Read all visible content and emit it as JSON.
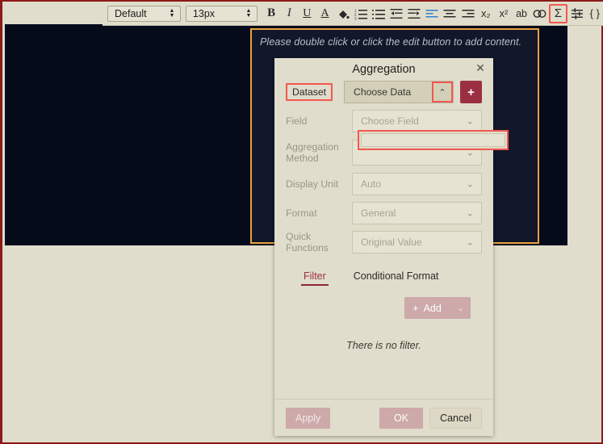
{
  "toolbar": {
    "font_family": {
      "value": "Default",
      "icon": "spinner-arrows-icon"
    },
    "font_size": {
      "value": "13px",
      "icon": "spinner-arrows-icon"
    },
    "buttons": [
      {
        "name": "bold",
        "glyph": "B",
        "icon": "bold-icon"
      },
      {
        "name": "italic",
        "glyph": "I",
        "icon": "italic-icon"
      },
      {
        "name": "underline",
        "glyph": "U",
        "icon": "underline-icon"
      },
      {
        "name": "font-color",
        "glyph": "A",
        "icon": "font-color-icon"
      },
      {
        "name": "fill-color",
        "glyph": "",
        "icon": "paint-bucket-icon"
      },
      {
        "name": "ordered-list",
        "glyph": "",
        "icon": "ordered-list-icon"
      },
      {
        "name": "unordered-list",
        "glyph": "",
        "icon": "unordered-list-icon"
      },
      {
        "name": "outdent",
        "glyph": "",
        "icon": "outdent-icon"
      },
      {
        "name": "indent",
        "glyph": "",
        "icon": "indent-icon"
      },
      {
        "name": "align-left",
        "glyph": "",
        "icon": "align-left-icon"
      },
      {
        "name": "align-center",
        "glyph": "",
        "icon": "align-center-icon"
      },
      {
        "name": "align-right",
        "glyph": "",
        "icon": "align-right-icon"
      },
      {
        "name": "subscript",
        "glyph": "x₂",
        "icon": "subscript-icon"
      },
      {
        "name": "superscript",
        "glyph": "x²",
        "icon": "superscript-icon"
      },
      {
        "name": "abbreviation",
        "glyph": "ab",
        "icon": "abbreviation-icon"
      },
      {
        "name": "link",
        "glyph": "",
        "icon": "link-icon"
      },
      {
        "name": "aggregation",
        "glyph": "Σ",
        "icon": "sigma-icon"
      },
      {
        "name": "settings",
        "glyph": "",
        "icon": "sliders-icon"
      },
      {
        "name": "parameter",
        "glyph": "{ }",
        "icon": "curly-braces-icon"
      }
    ]
  },
  "canvas": {
    "placeholder_hint": "Please double click or click the edit button to add content."
  },
  "dialog": {
    "title": "Aggregation",
    "close_label": "✕",
    "dataset": {
      "label": "Dataset",
      "value": "Choose Data",
      "caret": "⌃",
      "add_label": "+"
    },
    "fields": [
      {
        "label": "Field",
        "value": "Choose Field",
        "caret": "⌄"
      },
      {
        "label": "Aggregation Method",
        "value": "",
        "caret": "⌄"
      },
      {
        "label": "Display Unit",
        "value": "Auto",
        "caret": "⌄"
      },
      {
        "label": "Format",
        "value": "General",
        "caret": "⌄"
      },
      {
        "label": "Quick Functions",
        "value": "Original Value",
        "caret": "⌄"
      }
    ],
    "tabs": [
      {
        "label": "Filter",
        "active": true
      },
      {
        "label": "Conditional Format",
        "active": false
      }
    ],
    "add_filter": {
      "plus": "+",
      "label": "Add",
      "caret": "⌄"
    },
    "empty_filter_text": "There is no filter.",
    "footer": {
      "apply": "Apply",
      "ok": "OK",
      "cancel": "Cancel"
    }
  },
  "colors": {
    "page_bg": "#e0ddcc",
    "canvas_bg": "#060b1c",
    "accent_red": "#9b2f42",
    "highlight_outline": "#f2584f",
    "content_border": "#e8a33d",
    "frame_border": "#8b1a18"
  }
}
